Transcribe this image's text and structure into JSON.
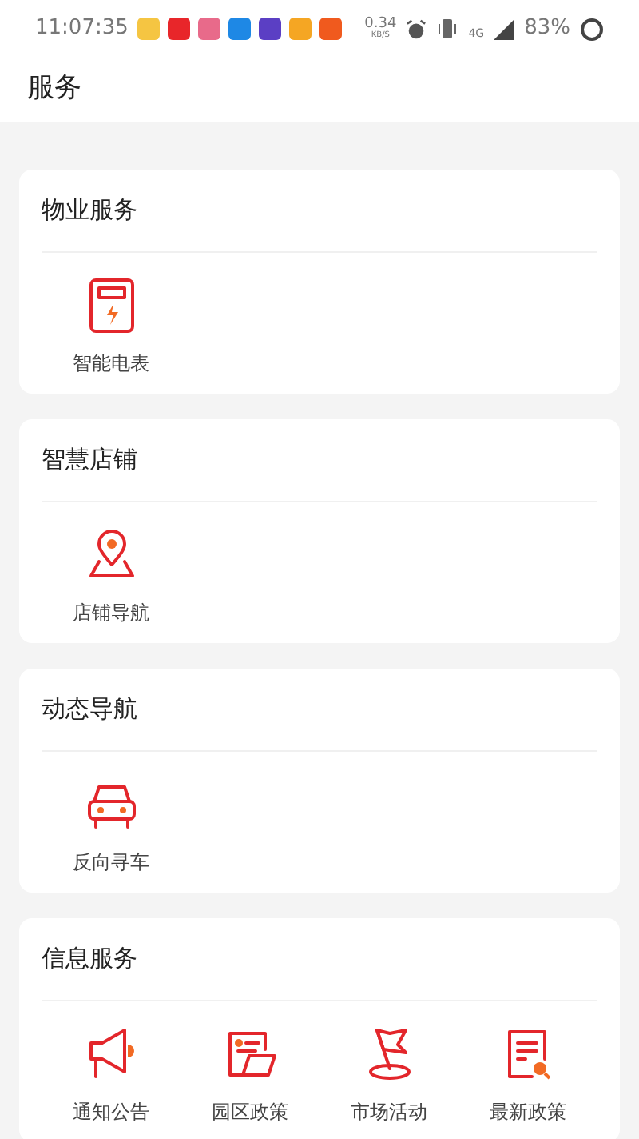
{
  "status_bar": {
    "time": "11:07:35",
    "speed": "0.34",
    "speed_unit": "KB/S",
    "network": "4G",
    "battery": "83%",
    "notifications": [
      {
        "color": "#f5c542"
      },
      {
        "color": "#e8262a"
      },
      {
        "color": "#e86a8a"
      },
      {
        "color": "#1e88e5"
      },
      {
        "color": "#5b3fc4"
      },
      {
        "color": "#f5a623"
      },
      {
        "color": "#f05a1e"
      }
    ]
  },
  "header": {
    "title": "服务"
  },
  "sections": [
    {
      "title": "物业服务",
      "items": [
        {
          "label": "智能电表",
          "kind": "meter"
        }
      ]
    },
    {
      "title": "智慧店铺",
      "items": [
        {
          "label": "店铺导航",
          "kind": "pin"
        }
      ]
    },
    {
      "title": "动态导航",
      "items": [
        {
          "label": "反向寻车",
          "kind": "car"
        }
      ]
    },
    {
      "title": "信息服务",
      "items": [
        {
          "label": "通知公告",
          "kind": "megaphone"
        },
        {
          "label": "园区政策",
          "kind": "folder"
        },
        {
          "label": "市场活动",
          "kind": "flag"
        },
        {
          "label": "最新政策",
          "kind": "document"
        }
      ]
    }
  ]
}
